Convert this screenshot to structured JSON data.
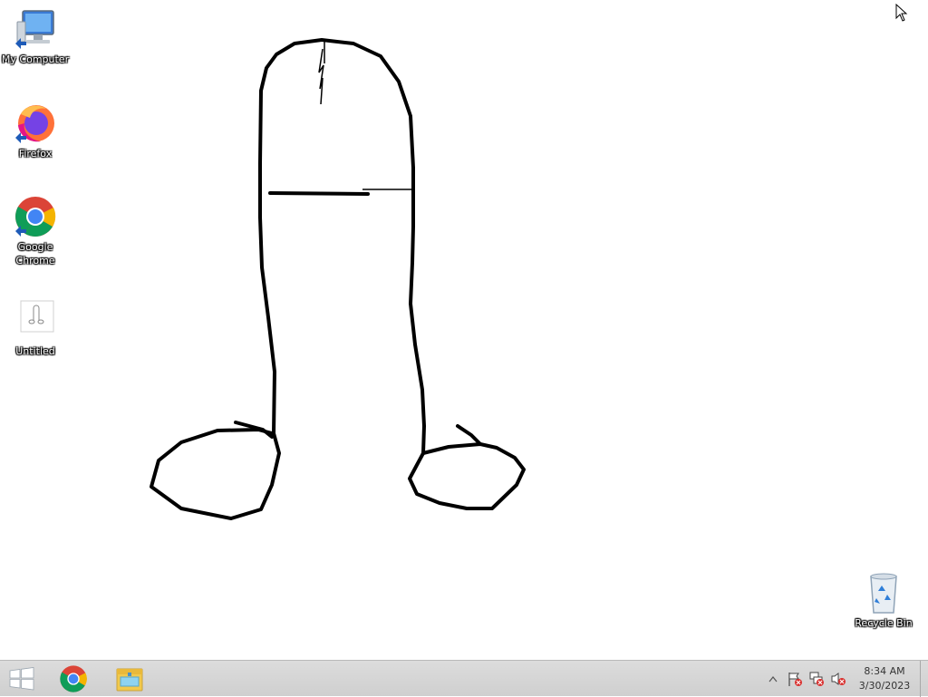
{
  "desktop": {
    "icons": [
      {
        "label": "My Computer",
        "icon": "computer-icon"
      },
      {
        "label": "Firefox",
        "icon": "firefox-icon"
      },
      {
        "label": "Google Chrome",
        "icon": "chrome-icon"
      },
      {
        "label": "Untitled",
        "icon": "paint-file-icon"
      },
      {
        "label": "Recycle Bin",
        "icon": "recycle-bin-icon"
      }
    ]
  },
  "taskbar": {
    "start_icon": "windows-logo-icon",
    "pinned": [
      {
        "name": "Google Chrome",
        "icon": "chrome-icon"
      },
      {
        "name": "File Explorer",
        "icon": "folder-icon"
      }
    ],
    "tray": {
      "icons": [
        "show-hidden-icons-icon",
        "action-center-flag-icon",
        "network-icon",
        "volume-muted-icon"
      ],
      "time": "8:34 AM",
      "date": "3/30/2023"
    }
  },
  "colors": {
    "desktop_background": "#ffffff",
    "taskbar_background": "#d6d6d6",
    "drawing_stroke": "#000000"
  }
}
